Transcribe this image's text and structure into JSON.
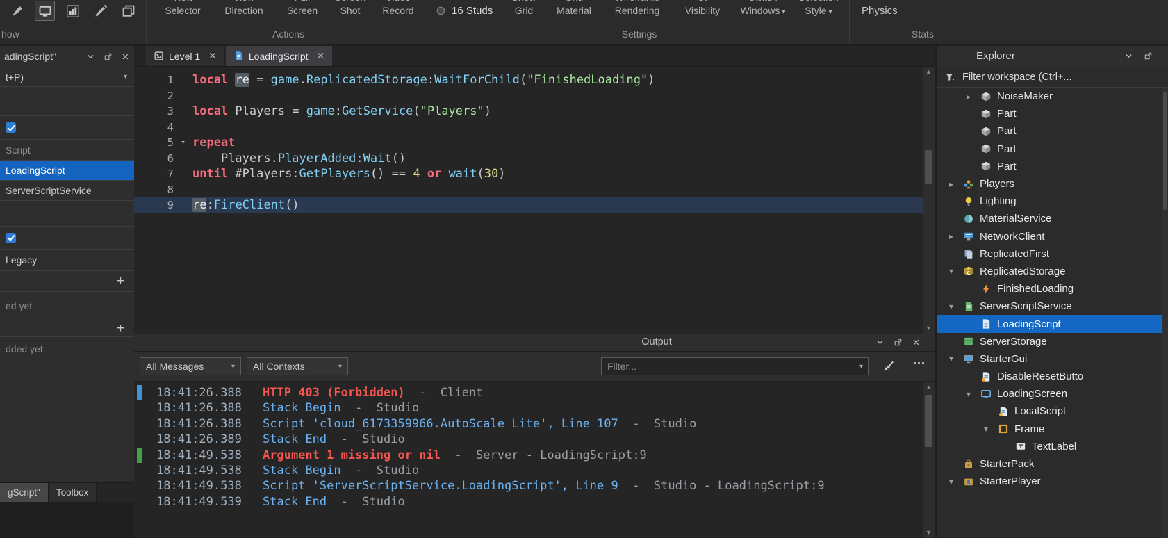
{
  "colors": {
    "selection_blue": "#1565c0",
    "keyword": "#f86d7c",
    "builtin": "#83d0f2",
    "string": "#a9e8a0",
    "number": "#d5d78a",
    "log_error": "#f2564f",
    "log_info": "#6cb2f2",
    "marker_blue": "#4292d6",
    "marker_green": "#43a047"
  },
  "ribbon": {
    "show_label": "how",
    "tool_icons": [
      {
        "icon": "brush",
        "active": false
      },
      {
        "icon": "screen",
        "active": true
      },
      {
        "icon": "chart",
        "active": false
      },
      {
        "icon": "wand",
        "active": false
      },
      {
        "icon": "copies",
        "active": false
      }
    ],
    "items": [
      {
        "id": "view-selector",
        "l1": "View",
        "l2": "Selector"
      },
      {
        "id": "view-direction",
        "l1": "View",
        "l2": "Direction"
      },
      {
        "id": "full-screen",
        "l1": "Full",
        "l2": "Screen"
      },
      {
        "id": "screen-shot",
        "l1": "Screen",
        "l2": "Shot"
      },
      {
        "id": "video-record",
        "l1": "Video",
        "l2": "Record"
      },
      {
        "id": "16-studs",
        "l1": "",
        "l2": "16 Studs",
        "style": "studs",
        "radio": true
      },
      {
        "id": "show-grid",
        "l1": "Show",
        "l2": "Grid"
      },
      {
        "id": "grid-material",
        "l1": "Grid",
        "l2": "Material"
      },
      {
        "id": "wireframe-rendering",
        "l1": "Wireframe",
        "l2": "Rendering"
      },
      {
        "id": "ui-visibility",
        "l1": "UI",
        "l2": "Visibility"
      },
      {
        "id": "switch-windows",
        "l1": "Switch",
        "l2": "Windows",
        "caret": true
      },
      {
        "id": "selection-style",
        "l1": "Selection",
        "l2": "Style",
        "caret": true
      },
      {
        "id": "physics",
        "l1": "",
        "l2": "Physics",
        "style": "single"
      }
    ],
    "groups": [
      "Actions",
      "Settings",
      "Stats"
    ]
  },
  "left_panel": {
    "title": "adingScript\"",
    "rows": [
      {
        "type": "combo",
        "text": "t+P)"
      },
      {
        "type": "spacer"
      },
      {
        "type": "check"
      },
      {
        "type": "mlabel",
        "text": "Script"
      },
      {
        "type": "selected",
        "text": "LoadingScript"
      },
      {
        "type": "label",
        "text": "ServerScriptService"
      },
      {
        "type": "spacer"
      },
      {
        "type": "check"
      },
      {
        "type": "label",
        "text": "Legacy"
      },
      {
        "type": "plus"
      },
      {
        "type": "mlabel",
        "text": "ed yet"
      },
      {
        "type": "plus"
      },
      {
        "type": "mlabel",
        "text": "dded yet"
      }
    ],
    "bottom_tabs": [
      {
        "label": "gScript\"",
        "active": true
      },
      {
        "label": "Toolbox",
        "active": false
      }
    ]
  },
  "editor": {
    "tabs": [
      {
        "label": "Level 1",
        "icon": "place",
        "active": false
      },
      {
        "label": "LoadingScript",
        "icon": "script-tab",
        "active": true
      }
    ],
    "lines": [
      {
        "n": 1,
        "tokens": [
          [
            "k",
            "local"
          ],
          [
            "d",
            " "
          ],
          [
            "hl",
            "re"
          ],
          [
            "d",
            " = "
          ],
          [
            "b",
            "game"
          ],
          [
            "d",
            "."
          ],
          [
            "b",
            "ReplicatedStorage"
          ],
          [
            "d",
            ":"
          ],
          [
            "b",
            "WaitForChild"
          ],
          [
            "d",
            "("
          ],
          [
            "s",
            "\"FinishedLoading\""
          ],
          [
            "d",
            ")"
          ]
        ]
      },
      {
        "n": 2,
        "tokens": []
      },
      {
        "n": 3,
        "tokens": [
          [
            "k",
            "local"
          ],
          [
            "d",
            " Players = "
          ],
          [
            "b",
            "game"
          ],
          [
            "d",
            ":"
          ],
          [
            "b",
            "GetService"
          ],
          [
            "d",
            "("
          ],
          [
            "s",
            "\"Players\""
          ],
          [
            "d",
            ")"
          ]
        ]
      },
      {
        "n": 4,
        "tokens": []
      },
      {
        "n": 5,
        "fold": true,
        "tokens": [
          [
            "k",
            "repeat"
          ]
        ]
      },
      {
        "n": 6,
        "tokens": [
          [
            "d",
            "    Players."
          ],
          [
            "b",
            "PlayerAdded"
          ],
          [
            "d",
            ":"
          ],
          [
            "b",
            "Wait"
          ],
          [
            "d",
            "()"
          ]
        ]
      },
      {
        "n": 7,
        "tokens": [
          [
            "k",
            "until"
          ],
          [
            "d",
            " #Players:"
          ],
          [
            "b",
            "GetPlayers"
          ],
          [
            "d",
            "() == "
          ],
          [
            "n2",
            "4"
          ],
          [
            "d",
            " "
          ],
          [
            "k",
            "or"
          ],
          [
            "d",
            " "
          ],
          [
            "b",
            "wait"
          ],
          [
            "d",
            "("
          ],
          [
            "n2",
            "30"
          ],
          [
            "d",
            ")"
          ]
        ]
      },
      {
        "n": 8,
        "tokens": []
      },
      {
        "n": 9,
        "current": true,
        "tokens": [
          [
            "hl",
            "re"
          ],
          [
            "d",
            ":"
          ],
          [
            "b",
            "FireClient"
          ],
          [
            "d",
            "()"
          ]
        ]
      }
    ]
  },
  "output": {
    "title": "Output",
    "combos": [
      "All Messages",
      "All Contexts"
    ],
    "filter_placeholder": "Filter...",
    "rows": [
      {
        "time": "18:41:26.388",
        "marker": "blue",
        "parts": [
          {
            "t": "HTTP 403 (Forbidden)",
            "c": "err"
          },
          {
            "t": "  -  Client",
            "c": "dim"
          }
        ]
      },
      {
        "time": "18:41:26.388",
        "parts": [
          {
            "t": "Stack Begin",
            "c": "info"
          },
          {
            "t": "  -  Studio",
            "c": "dim"
          }
        ]
      },
      {
        "time": "18:41:26.388",
        "parts": [
          {
            "t": "Script 'cloud_6173359966.AutoScale Lite', Line 107",
            "c": "info"
          },
          {
            "t": "  -  Studio",
            "c": "dim"
          }
        ]
      },
      {
        "time": "18:41:26.389",
        "parts": [
          {
            "t": "Stack End",
            "c": "info"
          },
          {
            "t": "  -  Studio",
            "c": "dim"
          }
        ]
      },
      {
        "time": "18:41:49.538",
        "marker": "green",
        "parts": [
          {
            "t": "Argument 1 missing or nil",
            "c": "err"
          },
          {
            "t": "  -  Server - LoadingScript:9",
            "c": "dim"
          }
        ]
      },
      {
        "time": "18:41:49.538",
        "parts": [
          {
            "t": "Stack Begin",
            "c": "info"
          },
          {
            "t": "  -  Studio",
            "c": "dim"
          }
        ]
      },
      {
        "time": "18:41:49.538",
        "parts": [
          {
            "t": "Script 'ServerScriptService.LoadingScript', Line 9",
            "c": "info"
          },
          {
            "t": "  -  Studio - LoadingScript:9",
            "c": "dim"
          }
        ]
      },
      {
        "time": "18:41:49.539",
        "parts": [
          {
            "t": "Stack End",
            "c": "info"
          },
          {
            "t": "  -  Studio",
            "c": "dim"
          }
        ]
      }
    ]
  },
  "explorer": {
    "title": "Explorer",
    "filter_text": "Filter workspace (Ctrl+...",
    "items": [
      {
        "level": 2,
        "arrow": "right",
        "icon": "part",
        "label": "NoiseMaker"
      },
      {
        "level": 2,
        "icon": "part",
        "label": "Part"
      },
      {
        "level": 2,
        "icon": "part",
        "label": "Part"
      },
      {
        "level": 2,
        "icon": "part",
        "label": "Part"
      },
      {
        "level": 2,
        "icon": "part",
        "label": "Part"
      },
      {
        "level": 1,
        "arrow": "right",
        "icon": "players",
        "label": "Players"
      },
      {
        "level": 1,
        "icon": "lighting",
        "label": "Lighting"
      },
      {
        "level": 1,
        "icon": "material",
        "label": "MaterialService"
      },
      {
        "level": 1,
        "arrow": "right",
        "icon": "network",
        "label": "NetworkClient"
      },
      {
        "level": 1,
        "icon": "replicated-first",
        "label": "ReplicatedFirst"
      },
      {
        "level": 1,
        "arrow": "down",
        "icon": "replicated-storage",
        "label": "ReplicatedStorage"
      },
      {
        "level": 2,
        "icon": "remote-event",
        "label": "FinishedLoading"
      },
      {
        "level": 1,
        "arrow": "down",
        "icon": "sss",
        "label": "ServerScriptService"
      },
      {
        "level": 2,
        "icon": "script",
        "label": "LoadingScript",
        "selected": true
      },
      {
        "level": 1,
        "icon": "server-storage",
        "label": "ServerStorage"
      },
      {
        "level": 1,
        "arrow": "down",
        "icon": "starter-gui",
        "label": "StarterGui"
      },
      {
        "level": 2,
        "icon": "local-script",
        "label": "DisableResetButto"
      },
      {
        "level": 2,
        "arrow": "down",
        "icon": "screen-gui",
        "label": "LoadingScreen"
      },
      {
        "level": 3,
        "icon": "local-script",
        "label": "LocalScript"
      },
      {
        "level": 3,
        "arrow": "down",
        "icon": "frame",
        "label": "Frame"
      },
      {
        "level": 4,
        "icon": "text-label",
        "label": "TextLabel"
      },
      {
        "level": 1,
        "icon": "starter-pack",
        "label": "StarterPack"
      },
      {
        "level": 1,
        "arrow": "down",
        "icon": "starter-player",
        "label": "StarterPlayer"
      }
    ]
  }
}
